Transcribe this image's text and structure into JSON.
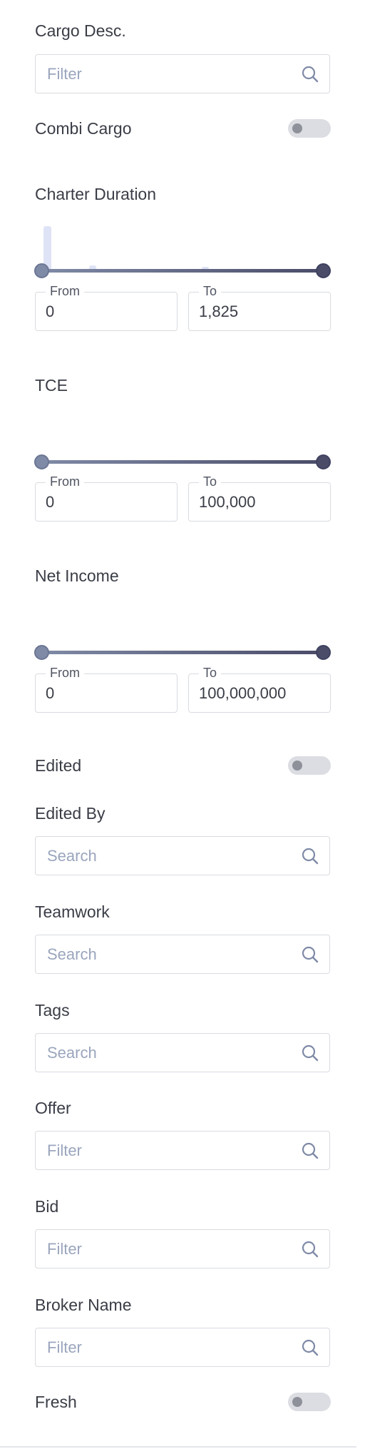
{
  "filters": {
    "cargo_desc": {
      "label": "Cargo Desc.",
      "placeholder": "Filter",
      "value": ""
    },
    "combi_cargo": {
      "label": "Combi Cargo",
      "enabled": false
    },
    "charter_duration": {
      "label": "Charter Duration",
      "from_label": "From",
      "to_label": "To",
      "from_value": "0",
      "to_value": "1,825"
    },
    "tce": {
      "label": "TCE",
      "from_label": "From",
      "to_label": "To",
      "from_value": "0",
      "to_value": "100,000"
    },
    "net_income": {
      "label": "Net Income",
      "from_label": "From",
      "to_label": "To",
      "from_value": "0",
      "to_value": "100,000,000"
    },
    "edited": {
      "label": "Edited",
      "enabled": false
    },
    "edited_by": {
      "label": "Edited By",
      "placeholder": "Search",
      "value": ""
    },
    "teamwork": {
      "label": "Teamwork",
      "placeholder": "Search",
      "value": ""
    },
    "tags": {
      "label": "Tags",
      "placeholder": "Search",
      "value": ""
    },
    "offer": {
      "label": "Offer",
      "placeholder": "Filter",
      "value": ""
    },
    "bid": {
      "label": "Bid",
      "placeholder": "Filter",
      "value": ""
    },
    "broker_name": {
      "label": "Broker Name",
      "placeholder": "Filter",
      "value": ""
    },
    "fresh": {
      "label": "Fresh",
      "enabled": false
    }
  },
  "icons": {
    "search": "search-icon",
    "toggle_knob": "toggle-knob"
  },
  "colors": {
    "label_text": "#3a3d46",
    "placeholder": "#9aa5bd",
    "border": "#d8dbe1",
    "slider_start": "#7f8aa6",
    "slider_end": "#4a4c68",
    "toggle_bg": "#dcdde2",
    "histogram": "#dfe3f6"
  }
}
